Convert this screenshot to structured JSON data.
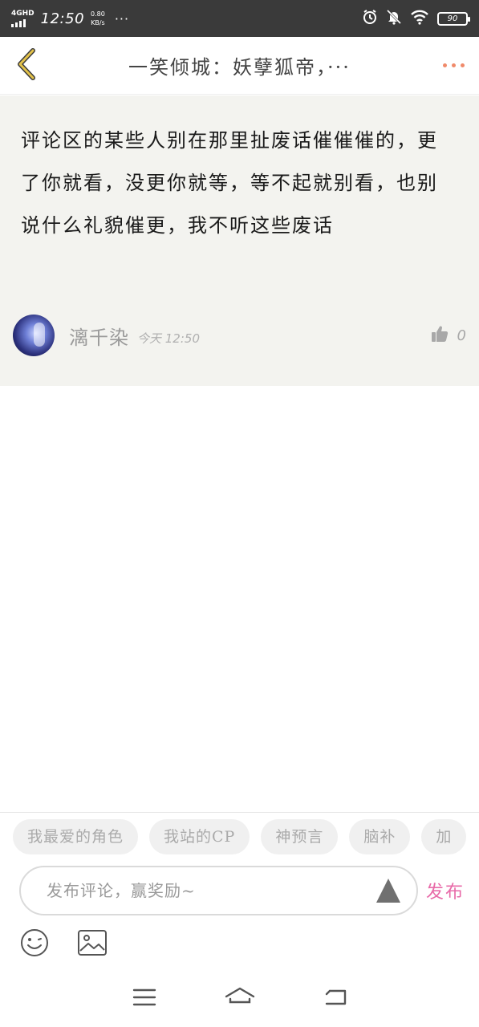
{
  "status_bar": {
    "network": "4GHD",
    "time": "12:50",
    "speed_value": "0.80",
    "speed_unit": "KB/s",
    "more": "···",
    "battery": "90"
  },
  "header": {
    "title": "一笑倾城：妖孽狐帝，···"
  },
  "comment": {
    "text": "评论区的某些人别在那里扯废话催催催的，更了你就看，没更你就等，等不起就别看，也别说什么礼貌催更，我不听这些废话",
    "username": "漓千染",
    "timestamp": "今天 12:50",
    "likes": "0"
  },
  "tags": [
    "我最爱的角色",
    "我站的CP",
    "神预言",
    "脑补",
    "加"
  ],
  "composer": {
    "placeholder": "发布评论，赢奖励~",
    "publish_label": "发布"
  },
  "colors": {
    "status_bar_bg": "#3a3a3a",
    "card_bg": "#f3f3ef",
    "back_accent": "#e3c24a",
    "more_accent": "#f08a6a",
    "publish_accent": "#e86aa8"
  },
  "icons": {
    "back": "chevron-left-icon",
    "more": "more-dots-icon",
    "like": "thumb-up-icon",
    "send": "send-arrow-icon",
    "emoji": "smiley-icon",
    "image": "image-icon",
    "nav_menu": "menu-icon",
    "nav_home": "home-icon",
    "nav_back": "return-icon"
  }
}
